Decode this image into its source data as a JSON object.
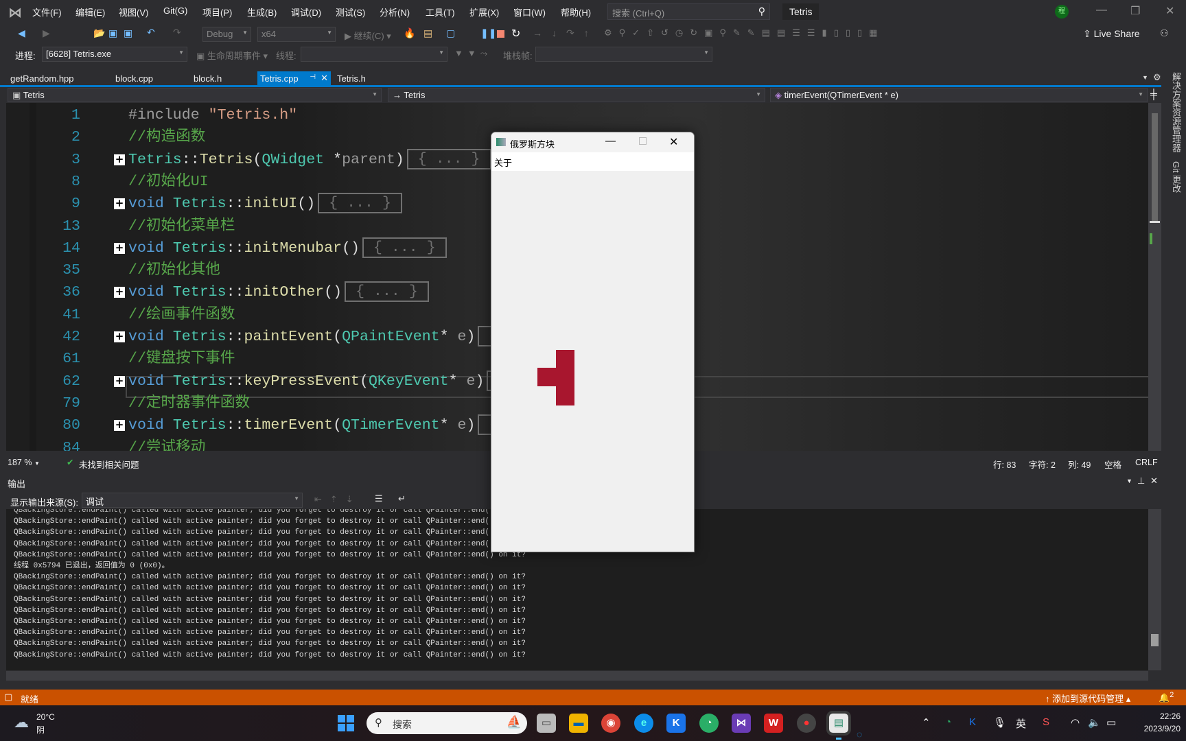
{
  "menubar": {
    "items": [
      "文件(F)",
      "编辑(E)",
      "视图(V)",
      "Git(G)",
      "项目(P)",
      "生成(B)",
      "调试(D)",
      "测试(S)",
      "分析(N)",
      "工具(T)",
      "扩展(X)",
      "窗口(W)",
      "帮助(H)"
    ],
    "search_placeholder": "搜索 (Ctrl+Q)",
    "solution_name": "Tetris",
    "avatar": "程"
  },
  "toolbar": {
    "config": "Debug",
    "platform": "x64",
    "continue_label": "继续(C)",
    "live_share": "Live Share"
  },
  "debug_toolbar": {
    "process_label": "进程:",
    "process_value": "[6628] Tetris.exe",
    "lifecycle_label": "生命周期事件",
    "thread_label": "线程:",
    "stackframe_label": "堆栈帧:"
  },
  "tabs": [
    {
      "label": "getRandom.hpp"
    },
    {
      "label": "block.cpp"
    },
    {
      "label": "block.h"
    },
    {
      "label": "Tetris.cpp",
      "active": true
    },
    {
      "label": "Tetris.h"
    }
  ],
  "navbar": {
    "scope": "Tetris",
    "class": "Tetris",
    "member": "timerEvent(QTimerEvent * e)"
  },
  "code_lines": [
    {
      "n": "1",
      "fold": false,
      "tokens": [
        [
          "#include ",
          "pp"
        ],
        [
          "\"Tetris.h\"",
          "str"
        ]
      ]
    },
    {
      "n": "2",
      "fold": false,
      "tokens": [
        [
          "//构造函数",
          "cm"
        ]
      ]
    },
    {
      "n": "3",
      "fold": true,
      "tokens": [
        [
          "Tetris",
          "ty"
        ],
        [
          "::",
          "pl"
        ],
        [
          "Tetris",
          "fn"
        ],
        [
          "(",
          "pl"
        ],
        [
          "QWidget",
          "ty"
        ],
        [
          " *",
          "pl"
        ],
        [
          "parent",
          "pa"
        ],
        [
          ")",
          "pl"
        ]
      ]
    },
    {
      "n": "8",
      "fold": false,
      "tokens": [
        [
          "//初始化UI",
          "cm"
        ]
      ]
    },
    {
      "n": "9",
      "fold": true,
      "tokens": [
        [
          "void",
          "kw"
        ],
        [
          " ",
          "pl"
        ],
        [
          "Tetris",
          "ty"
        ],
        [
          "::",
          "pl"
        ],
        [
          "initUI",
          "fn"
        ],
        [
          "()",
          "pl"
        ]
      ]
    },
    {
      "n": "13",
      "fold": false,
      "tokens": [
        [
          "//初始化菜单栏",
          "cm"
        ]
      ]
    },
    {
      "n": "14",
      "fold": true,
      "tokens": [
        [
          "void",
          "kw"
        ],
        [
          " ",
          "pl"
        ],
        [
          "Tetris",
          "ty"
        ],
        [
          "::",
          "pl"
        ],
        [
          "initMenubar",
          "fn"
        ],
        [
          "()",
          "pl"
        ]
      ]
    },
    {
      "n": "35",
      "fold": false,
      "tokens": [
        [
          "//初始化其他",
          "cm"
        ]
      ]
    },
    {
      "n": "36",
      "fold": true,
      "tokens": [
        [
          "void",
          "kw"
        ],
        [
          " ",
          "pl"
        ],
        [
          "Tetris",
          "ty"
        ],
        [
          "::",
          "pl"
        ],
        [
          "initOther",
          "fn"
        ],
        [
          "()",
          "pl"
        ]
      ]
    },
    {
      "n": "41",
      "fold": false,
      "tokens": [
        [
          "//绘画事件函数",
          "cm"
        ]
      ]
    },
    {
      "n": "42",
      "fold": true,
      "tokens": [
        [
          "void",
          "kw"
        ],
        [
          " ",
          "pl"
        ],
        [
          "Tetris",
          "ty"
        ],
        [
          "::",
          "pl"
        ],
        [
          "paintEvent",
          "fn"
        ],
        [
          "(",
          "pl"
        ],
        [
          "QPaintEvent",
          "ty"
        ],
        [
          "* ",
          "pl"
        ],
        [
          "e",
          "pa"
        ],
        [
          ")",
          "pl"
        ]
      ]
    },
    {
      "n": "61",
      "fold": false,
      "tokens": [
        [
          "//键盘按下事件",
          "cm"
        ]
      ]
    },
    {
      "n": "62",
      "fold": true,
      "tokens": [
        [
          "void",
          "kw"
        ],
        [
          " ",
          "pl"
        ],
        [
          "Tetris",
          "ty"
        ],
        [
          "::",
          "pl"
        ],
        [
          "keyPressEvent",
          "fn"
        ],
        [
          "(",
          "pl"
        ],
        [
          "QKeyEvent",
          "ty"
        ],
        [
          "* ",
          "pl"
        ],
        [
          "e",
          "pa"
        ],
        [
          ")",
          "pl"
        ]
      ]
    },
    {
      "n": "79",
      "fold": false,
      "tokens": [
        [
          "//定时器事件函数",
          "cm"
        ]
      ]
    },
    {
      "n": "80",
      "fold": true,
      "tokens": [
        [
          "void",
          "kw"
        ],
        [
          " ",
          "pl"
        ],
        [
          "Tetris",
          "ty"
        ],
        [
          "::",
          "pl"
        ],
        [
          "timerEvent",
          "fn"
        ],
        [
          "(",
          "pl"
        ],
        [
          "QTimerEvent",
          "ty"
        ],
        [
          "* ",
          "pl"
        ],
        [
          "e",
          "pa"
        ],
        [
          ")",
          "pl"
        ]
      ]
    },
    {
      "n": "84",
      "fold": false,
      "tokens": [
        [
          "//尝试移动",
          "cm"
        ]
      ]
    }
  ],
  "collapsed_label": "{ ... }",
  "editor_status": {
    "zoom": "187 %",
    "issues": "未找到相关问题",
    "line": "行: 83",
    "char": "字符: 2",
    "col": "列: 49",
    "indent": "空格",
    "eol": "CRLF"
  },
  "output": {
    "title": "输出",
    "source_label": "显示输出来源(S):",
    "source_value": "调试",
    "lines": [
      "QBackingStore::endPaint() called with active painter; did you forget to destroy it or call QPainter::end() on it?",
      "QBackingStore::endPaint() called with active painter; did you forget to destroy it or call QPainter::end() on it?",
      "QBackingStore::endPaint() called with active painter; did you forget to destroy it or call QPainter::end() on it?",
      "QBackingStore::endPaint() called with active painter; did you forget to destroy it or call QPainter::end() on it?",
      "QBackingStore::endPaint() called with active painter; did you forget to destroy it or call QPainter::end() on it?",
      "线程 0x5794 已退出，返回值为 0 (0x0)。",
      "QBackingStore::endPaint() called with active painter; did you forget to destroy it or call QPainter::end() on it?",
      "QBackingStore::endPaint() called with active painter; did you forget to destroy it or call QPainter::end() on it?",
      "QBackingStore::endPaint() called with active painter; did you forget to destroy it or call QPainter::end() on it?",
      "QBackingStore::endPaint() called with active painter; did you forget to destroy it or call QPainter::end() on it?",
      "QBackingStore::endPaint() called with active painter; did you forget to destroy it or call QPainter::end() on it?",
      "QBackingStore::endPaint() called with active painter; did you forget to destroy it or call QPainter::end() on it?",
      "QBackingStore::endPaint() called with active painter; did you forget to destroy it or call QPainter::end() on it?",
      "QBackingStore::endPaint() called with active painter; did you forget to destroy it or call QPainter::end() on it?"
    ]
  },
  "right_sidebar": [
    "解决方案资源管理器",
    "Git 更改"
  ],
  "statusbar": {
    "ready": "就绪",
    "source_control": "添加到源代码管理",
    "notifications": "2"
  },
  "tetris_window": {
    "title": "俄罗斯方块",
    "menu": "关于",
    "block_color": "#a8162e"
  },
  "taskbar": {
    "weather_temp": "20°C",
    "weather_desc": "阴",
    "search": "搜索",
    "ime": "英",
    "time": "22:26",
    "date": "2023/9/20"
  },
  "colors": {
    "accent": "#007acc",
    "status_bar": "#ca5100"
  }
}
